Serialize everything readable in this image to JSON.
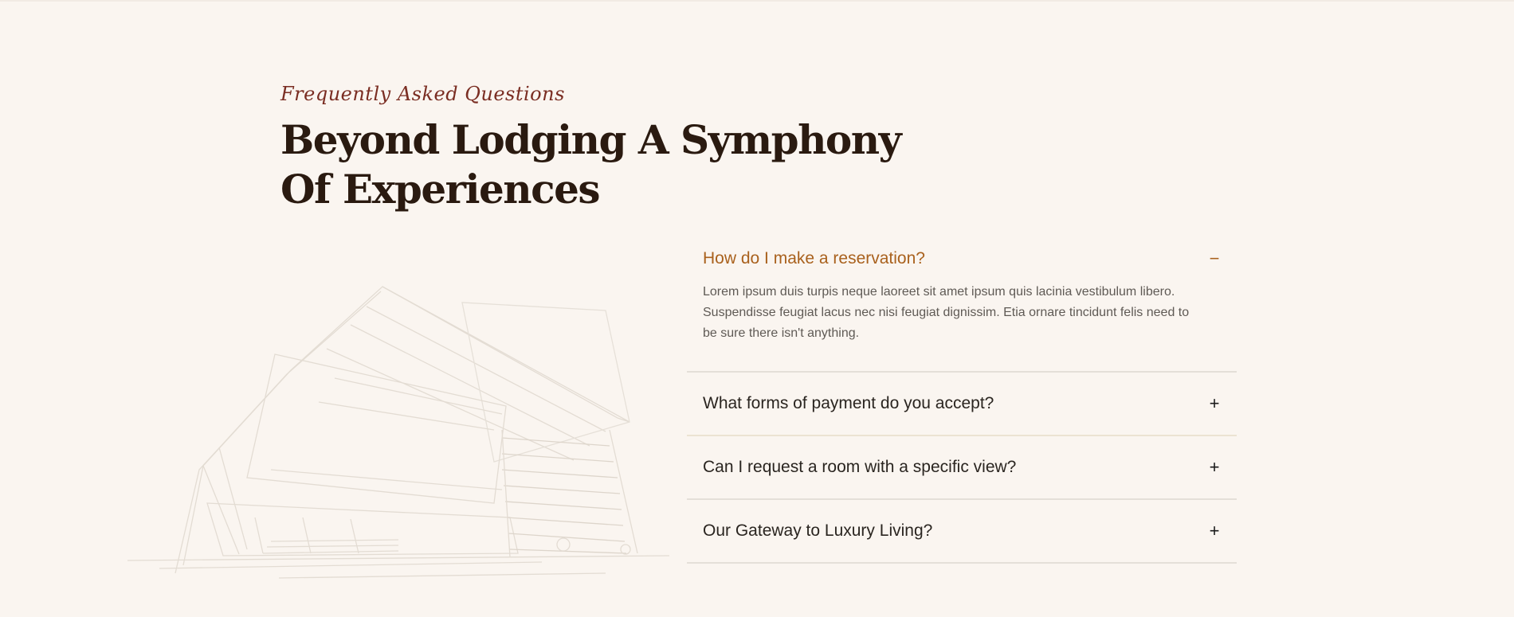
{
  "section": {
    "eyebrow": "Frequently Asked Questions",
    "heading_line1": "Beyond Lodging A Symphony",
    "heading_line2": "Of Experiences"
  },
  "faq": {
    "items": [
      {
        "question": "How do I make a reservation?",
        "toggle": "−",
        "answer": "Lorem ipsum duis turpis neque laoreet sit amet ipsum quis lacinia vestibulum libero. Suspendisse feugiat lacus nec nisi feugiat dignissim. Etia ornare tincidunt felis need to be sure there isn't anything.",
        "expanded": true
      },
      {
        "question": "What forms of payment do you accept?",
        "toggle": "+",
        "expanded": false
      },
      {
        "question": "Can I request a room with a specific view?",
        "toggle": "+",
        "expanded": false
      },
      {
        "question": "Our Gateway to Luxury Living?",
        "toggle": "+",
        "expanded": false
      }
    ]
  },
  "colors": {
    "background": "#faf5f0",
    "accent": "#a9611d",
    "eyebrow": "#7a2d22",
    "heading": "#2a1a10"
  },
  "illustration": {
    "icon": "building-sketch-icon"
  }
}
